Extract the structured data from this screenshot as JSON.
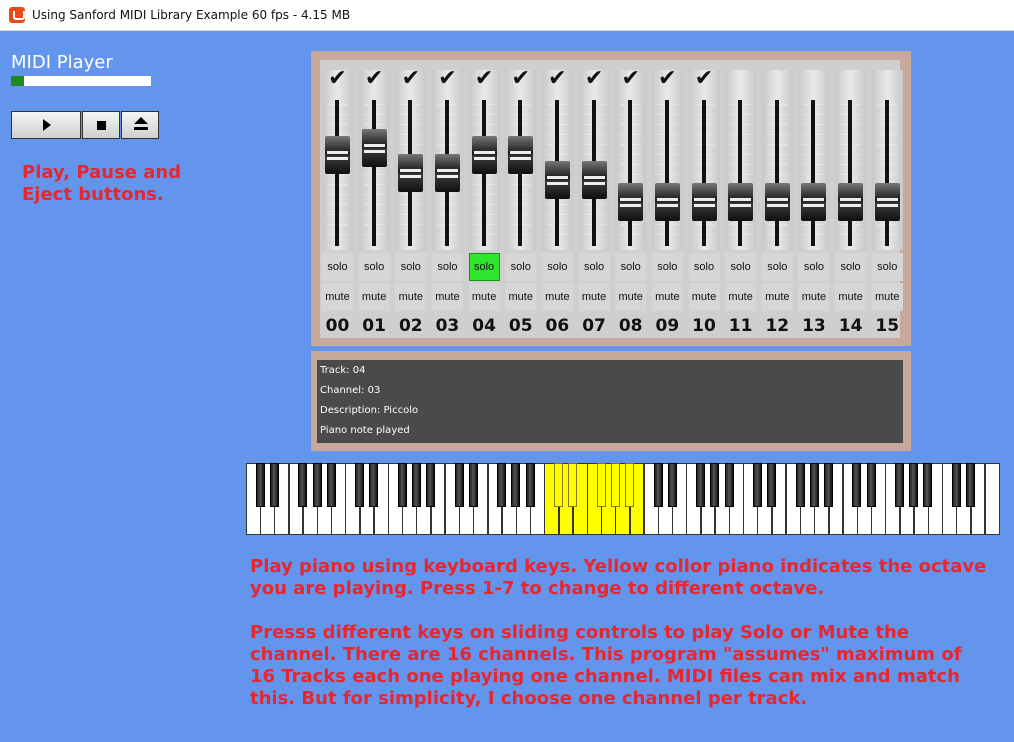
{
  "window": {
    "title": "Using Sanford MIDI Library Example 60 fps - 4.15 MB",
    "icon": "monogame-icon"
  },
  "player": {
    "title": "MIDI Player",
    "progress_percent": 9,
    "buttons": [
      {
        "name": "play",
        "icon": "play-icon"
      },
      {
        "name": "stop",
        "icon": "stop-icon"
      },
      {
        "name": "eject",
        "icon": "eject-icon"
      }
    ],
    "help": "Play, Pause and Eject buttons."
  },
  "mixer": {
    "solo_label": "solo",
    "mute_label": "mute",
    "active_solo_color": "#2ee62e",
    "channels": [
      {
        "number": "00",
        "checked": true,
        "level": 0.62,
        "solo": false
      },
      {
        "number": "01",
        "checked": true,
        "level": 0.69,
        "solo": false
      },
      {
        "number": "02",
        "checked": true,
        "level": 0.44,
        "solo": false
      },
      {
        "number": "03",
        "checked": true,
        "level": 0.44,
        "solo": false
      },
      {
        "number": "04",
        "checked": true,
        "level": 0.62,
        "solo": true
      },
      {
        "number": "05",
        "checked": true,
        "level": 0.62,
        "solo": false
      },
      {
        "number": "06",
        "checked": true,
        "level": 0.37,
        "solo": false
      },
      {
        "number": "07",
        "checked": true,
        "level": 0.37,
        "solo": false
      },
      {
        "number": "08",
        "checked": true,
        "level": 0.15,
        "solo": false
      },
      {
        "number": "09",
        "checked": true,
        "level": 0.15,
        "solo": false
      },
      {
        "number": "10",
        "checked": true,
        "level": 0.15,
        "solo": false
      },
      {
        "number": "11",
        "checked": false,
        "level": 0.15,
        "solo": false
      },
      {
        "number": "12",
        "checked": false,
        "level": 0.15,
        "solo": false
      },
      {
        "number": "13",
        "checked": false,
        "level": 0.15,
        "solo": false
      },
      {
        "number": "14",
        "checked": false,
        "level": 0.15,
        "solo": false
      },
      {
        "number": "15",
        "checked": false,
        "level": 0.15,
        "solo": false
      }
    ]
  },
  "info": {
    "lines": [
      "Track: 04",
      "Channel: 03",
      "Description: Piccolo",
      "Piano note played"
    ]
  },
  "piano": {
    "white_keys": 53,
    "highlight_octave_start": 21,
    "highlight_octave_length": 7,
    "highlight_color": "#ffff00"
  },
  "help": {
    "paragraph1": "Play piano using keyboard keys.  Yellow collor piano indicates the octave you are playing. Press 1-7 to change to different octave.",
    "paragraph2": "Presss different keys on sliding controls to play Solo or Mute the channel. There are 16 channels.  This program \"assumes\" maximum of 16 Tracks each one playing one channel.  MIDI files can mix and match this.  But for simplicity, I choose one channel per track."
  }
}
